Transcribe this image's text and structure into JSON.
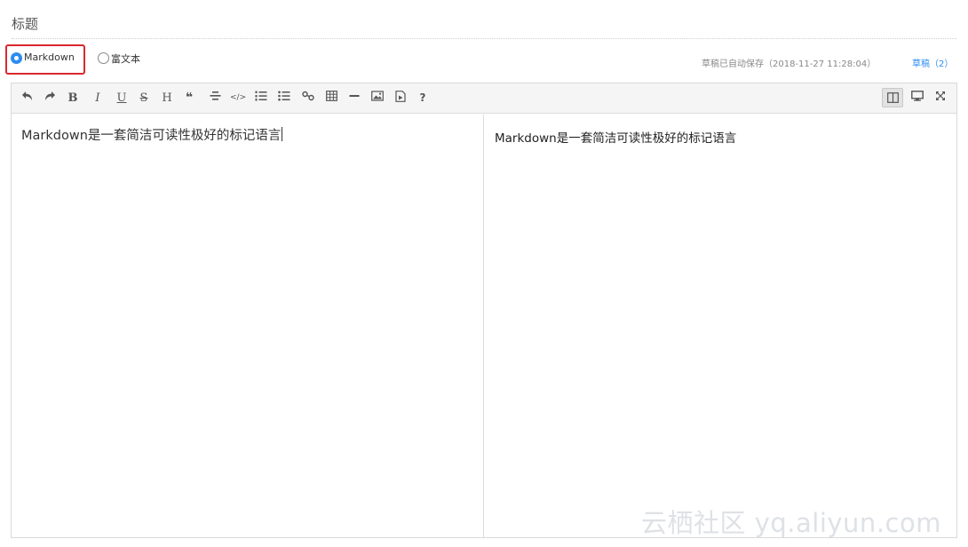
{
  "title": {
    "placeholder": "标题"
  },
  "editor_mode": {
    "options": [
      {
        "label": "Markdown",
        "checked": true
      },
      {
        "label": "富文本",
        "checked": false
      }
    ]
  },
  "status": {
    "autosave": "草稿已自动保存（2018-11-27 11:28:04）",
    "drafts_link": "草稿（2）"
  },
  "toolbar": {
    "left": [
      {
        "name": "undo-icon",
        "label": ""
      },
      {
        "name": "redo-icon",
        "label": ""
      },
      {
        "name": "bold-icon",
        "label": "B"
      },
      {
        "name": "italic-icon",
        "label": "I"
      },
      {
        "name": "underline-icon",
        "label": "U"
      },
      {
        "name": "strikethrough-icon",
        "label": "S"
      },
      {
        "name": "heading-icon",
        "label": "H"
      },
      {
        "name": "quote-icon",
        "label": "❝"
      },
      {
        "name": "align-center-icon",
        "label": ""
      },
      {
        "name": "code-icon",
        "label": "</>"
      },
      {
        "name": "ordered-list-icon",
        "label": ""
      },
      {
        "name": "unordered-list-icon",
        "label": ""
      },
      {
        "name": "link-icon",
        "label": ""
      },
      {
        "name": "table-icon",
        "label": ""
      },
      {
        "name": "horizontal-rule-icon",
        "label": ""
      },
      {
        "name": "image-icon",
        "label": ""
      },
      {
        "name": "video-icon",
        "label": ""
      },
      {
        "name": "help-icon",
        "label": "?"
      }
    ],
    "right": [
      {
        "name": "split-view-icon",
        "active": true
      },
      {
        "name": "preview-icon",
        "active": false
      },
      {
        "name": "fullscreen-icon",
        "active": false
      }
    ]
  },
  "content": {
    "source": "Markdown是一套简洁可读性极好的标记语言",
    "preview": "Markdown是一套简洁可读性极好的标记语言"
  },
  "watermark": "云栖社区 yq.aliyun.com",
  "colors": {
    "accent": "#2d8cf0",
    "highlight_border": "#d9282f"
  }
}
